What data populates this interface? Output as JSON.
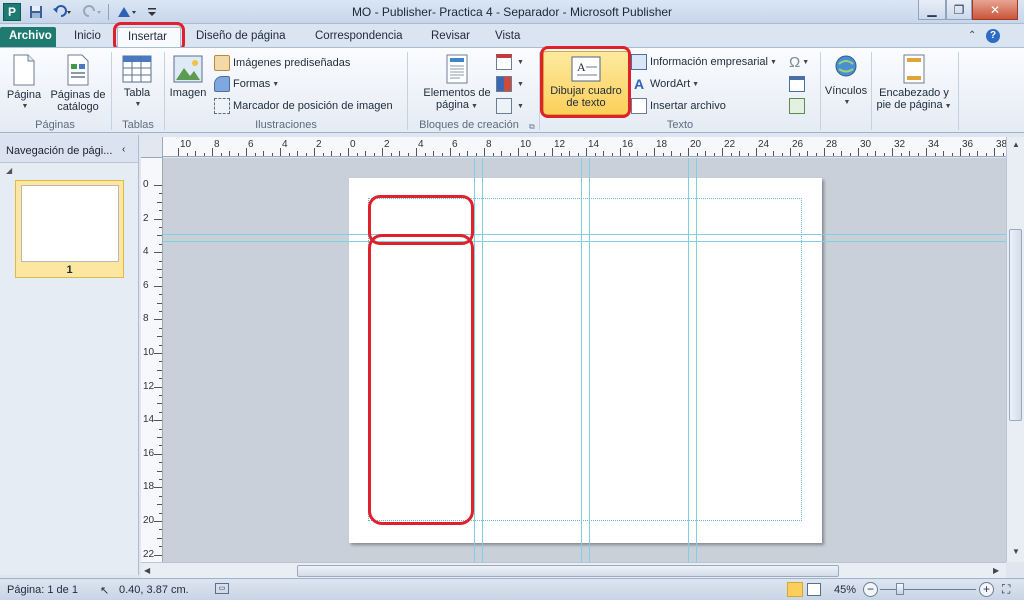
{
  "window": {
    "title": "MO - Publisher- Practica 4 - Separador - Microsoft Publisher",
    "app_icon": "P"
  },
  "tabs": [
    {
      "label": "Archivo"
    },
    {
      "label": "Inicio"
    },
    {
      "label": "Insertar"
    },
    {
      "label": "Diseño de página"
    },
    {
      "label": "Correspondencia"
    },
    {
      "label": "Revisar"
    },
    {
      "label": "Vista"
    }
  ],
  "ribbon": {
    "paginas": {
      "label": "Páginas",
      "pagina": "Página",
      "catalogo": "Páginas de catálogo"
    },
    "tablas": {
      "label": "Tablas",
      "tabla": "Tabla"
    },
    "ilustraciones": {
      "label": "Ilustraciones",
      "imagen": "Imagen",
      "imagenes_prediseñadas": "Imágenes prediseñadas",
      "formas": "Formas",
      "marcador": "Marcador de posición de imagen"
    },
    "bloques": {
      "label": "Bloques de creación",
      "elementos": "Elementos de página"
    },
    "texto": {
      "label": "Texto",
      "dibujar": "Dibujar cuadro de texto",
      "informacion": "Información empresarial",
      "wordart": "WordArt",
      "insertar_archivo": "Insertar archivo"
    },
    "vinculos": "Vínculos",
    "encabezado": "Encabezado y pie de página"
  },
  "nav": {
    "title": "Navegación de pági...",
    "page_number": "1"
  },
  "rulers": {
    "h_labels": [
      "10",
      "8",
      "6",
      "4",
      "2",
      "0",
      "2",
      "4",
      "6",
      "8",
      "10",
      "12",
      "14",
      "16",
      "18",
      "20",
      "22",
      "24",
      "26",
      "28",
      "30",
      "32",
      "34",
      "36",
      "38"
    ],
    "v_labels": [
      "0",
      "2",
      "4",
      "6",
      "8",
      "10",
      "12",
      "14",
      "16",
      "18",
      "20",
      "22"
    ]
  },
  "status": {
    "page": "Página: 1 de 1",
    "position": "0.40, 3.87 cm.",
    "zoom": "45%"
  },
  "colors": {
    "file_tab": "#1f7a72",
    "highlight": "#e0202a",
    "active_button": "#fcd86a",
    "guides": "#7fd0e0"
  }
}
